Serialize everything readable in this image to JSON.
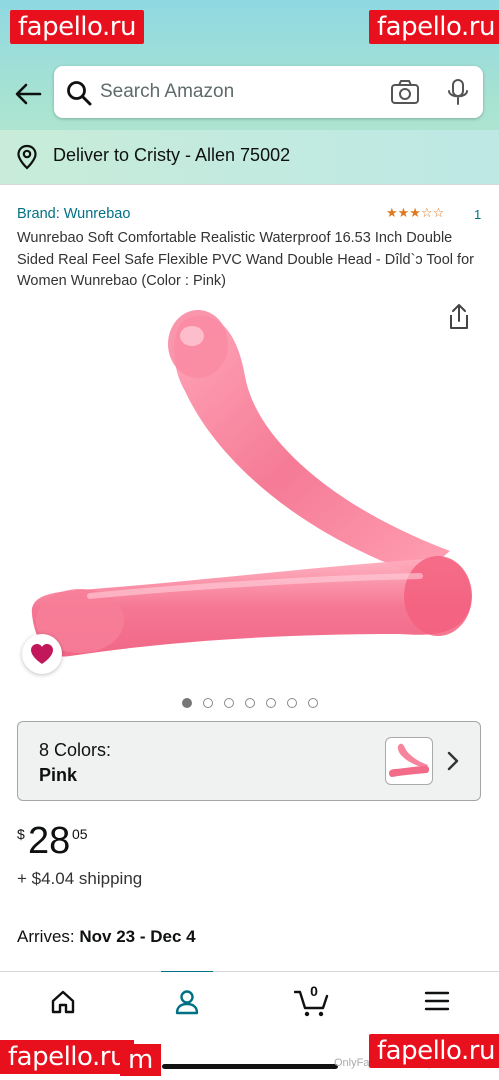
{
  "watermarks": {
    "top_left": "fapello.ru",
    "top_right": "fapello.ru",
    "bottom_left": "fapello.ru",
    "bottom_left_extra": "m",
    "bottom_right": "fapello.ru",
    "bottom_center": "OnlyFans.com/stacystarr"
  },
  "search": {
    "placeholder": "Search Amazon"
  },
  "delivery": {
    "text": "Deliver to Cristy - Allen 75002"
  },
  "product": {
    "brand": "Brand: Wunrebao",
    "stars": "★★★☆☆",
    "rating": 3,
    "rating_count": "1",
    "title": "Wunrebao Soft Comfortable Realistic Waterproof 16.53 Inch Double Sided Real Feel Safe Flexible PVC Wand Double Head - Dîld`ɔ Tool for Women Wunrebao (Color : Pink)",
    "image_index": 1,
    "image_count": 7
  },
  "variant": {
    "label": "8 Colors:",
    "value": "Pink"
  },
  "price": {
    "currency": "$",
    "whole": "28",
    "fraction": "05",
    "shipping": "+ $4.04 shipping"
  },
  "delivery_estimate": {
    "label": "Arrives:",
    "dates": "Nov 23 - Dec 4"
  },
  "bottom_nav": {
    "cart_count": "0",
    "active": "account"
  },
  "colors": {
    "accent": "#007185",
    "header": "#a8e3d2",
    "star": "#de7921",
    "watermark": "#e8101c"
  }
}
